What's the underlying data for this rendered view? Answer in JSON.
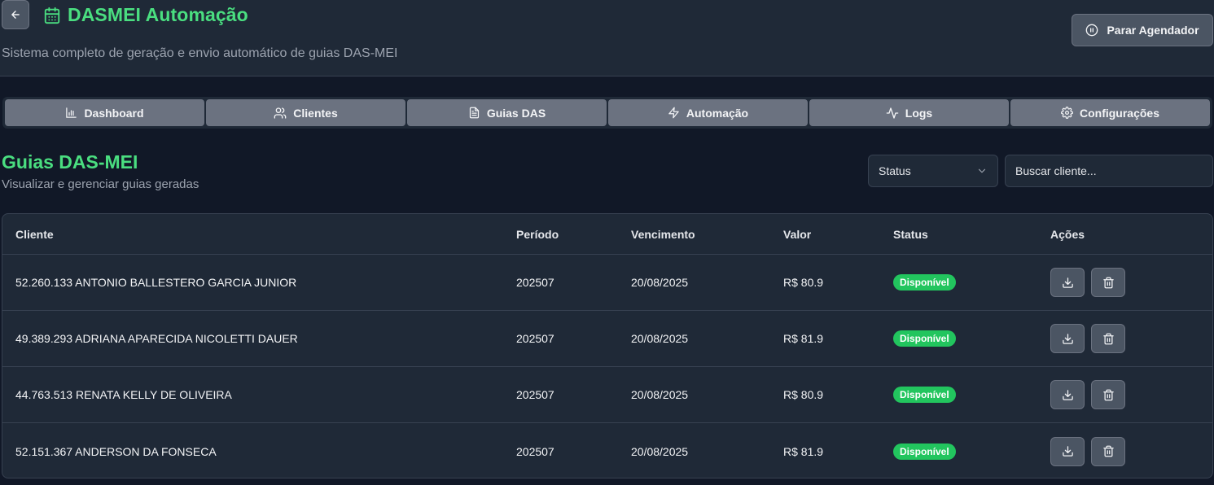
{
  "header": {
    "title": "DASMEI Automação",
    "subtitle": "Sistema completo de geração e envio automático de guias DAS-MEI",
    "stop_button": "Parar Agendador"
  },
  "tabs": [
    {
      "label": "Dashboard",
      "icon": "bar-chart-icon"
    },
    {
      "label": "Clientes",
      "icon": "users-icon"
    },
    {
      "label": "Guias DAS",
      "icon": "file-text-icon"
    },
    {
      "label": "Automação",
      "icon": "zap-icon"
    },
    {
      "label": "Logs",
      "icon": "activity-icon"
    },
    {
      "label": "Configurações",
      "icon": "gear-icon"
    }
  ],
  "section": {
    "title": "Guias DAS-MEI",
    "subtitle": "Visualizar e gerenciar guias geradas"
  },
  "filters": {
    "status_label": "Status",
    "search_placeholder": "Buscar cliente..."
  },
  "table": {
    "headers": {
      "cliente": "Cliente",
      "periodo": "Período",
      "vencimento": "Vencimento",
      "valor": "Valor",
      "status": "Status",
      "acoes": "Ações"
    },
    "rows": [
      {
        "cliente": "52.260.133 ANTONIO BALLESTERO GARCIA JUNIOR",
        "periodo": "202507",
        "vencimento": "20/08/2025",
        "valor": "R$ 80.9",
        "status": "Disponível"
      },
      {
        "cliente": "49.389.293 ADRIANA APARECIDA NICOLETTI DAUER",
        "periodo": "202507",
        "vencimento": "20/08/2025",
        "valor": "R$ 81.9",
        "status": "Disponível"
      },
      {
        "cliente": "44.763.513 RENATA KELLY DE OLIVEIRA",
        "periodo": "202507",
        "vencimento": "20/08/2025",
        "valor": "R$ 80.9",
        "status": "Disponível"
      },
      {
        "cliente": "52.151.367 ANDERSON DA FONSECA",
        "periodo": "202507",
        "vencimento": "20/08/2025",
        "valor": "R$ 81.9",
        "status": "Disponível"
      }
    ]
  },
  "colors": {
    "accent": "#4ade80",
    "background": "#111827",
    "panel": "#1f2937",
    "badge": "#22c55e"
  }
}
